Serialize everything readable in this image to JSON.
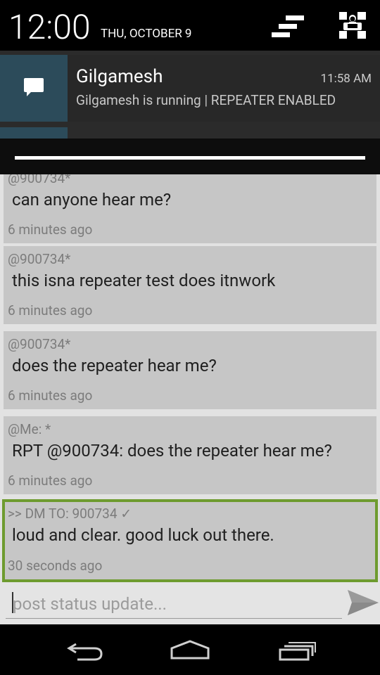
{
  "status": {
    "time": "12:00",
    "date": "THU, OCTOBER 9"
  },
  "header_icons": [
    "sort-notifications-icon",
    "quick-settings-icon"
  ],
  "notification": {
    "title": "Gilgamesh",
    "time": "11:58 AM",
    "text": "Gilgamesh is running | REPEATER ENABLED",
    "icon": "chat-bubble-icon"
  },
  "messages": [
    {
      "from": "@900734*",
      "body": "can anyone hear me?",
      "ago": "6 minutes ago"
    },
    {
      "from": "@900734*",
      "body": "this isna repeater test does itnwork",
      "ago": "6 minutes ago"
    },
    {
      "from": "@900734*",
      "body": "does the repeater hear me?",
      "ago": "6 minutes ago"
    },
    {
      "from": "@Me:  *",
      "body": "RPT @900734: does the repeater hear me?",
      "ago": "6 minutes ago"
    },
    {
      "from": ">> DM TO: 900734 ✓",
      "body": "loud and clear. good luck out there.",
      "ago": "30 seconds ago",
      "highlight": "#6e9b2f"
    }
  ],
  "compose": {
    "placeholder": "post status update...",
    "value": ""
  },
  "nav": [
    "back-icon",
    "home-icon",
    "recents-icon"
  ],
  "colors": {
    "accent_border": "#6e9b2f",
    "notification_icon_bg": "#2c4b5a",
    "card_bg": "#c6c6c6"
  }
}
